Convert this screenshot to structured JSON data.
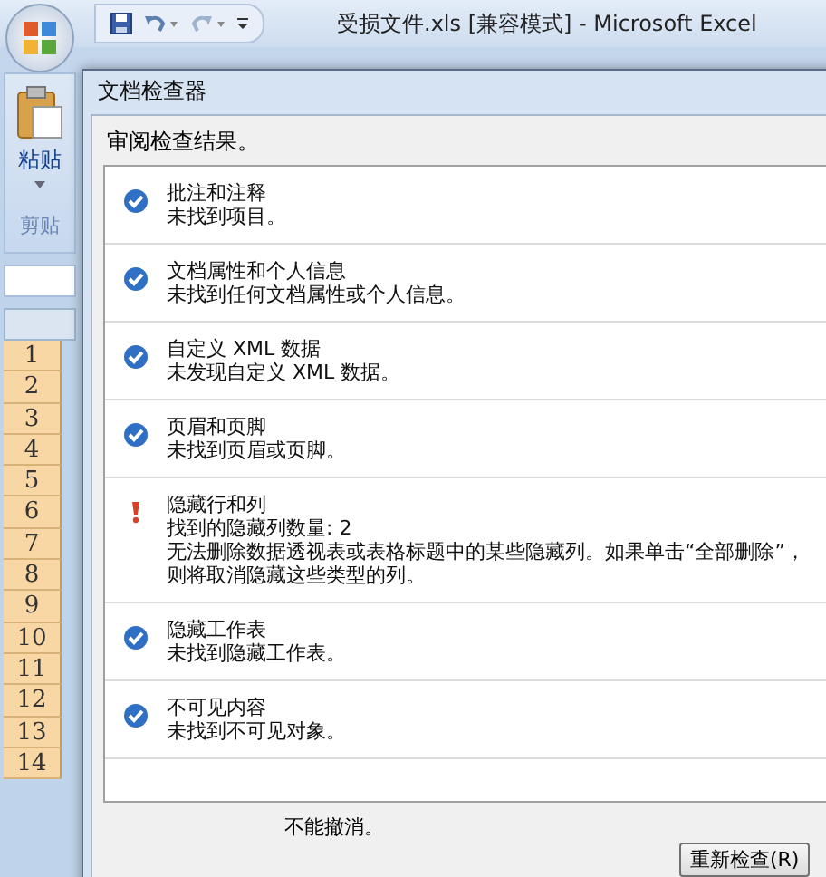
{
  "window": {
    "title": "受损文件.xls  [兼容模式] - Microsoft Excel"
  },
  "ribbon": {
    "paste_label": "粘贴",
    "group_label": "剪贴"
  },
  "sheet": {
    "row_numbers": [
      "1",
      "2",
      "3",
      "4",
      "5",
      "6",
      "7",
      "8",
      "9",
      "10",
      "11",
      "12",
      "13",
      "14"
    ]
  },
  "dialog": {
    "title": "文档检查器",
    "header": "审阅检查结果。",
    "results": [
      {
        "issue_found": false,
        "title": "批注和注释",
        "details": [
          "未找到项目。"
        ]
      },
      {
        "issue_found": false,
        "title": "文档属性和个人信息",
        "details": [
          "未找到任何文档属性或个人信息。"
        ]
      },
      {
        "issue_found": false,
        "title": "自定义 XML 数据",
        "details": [
          "未发现自定义 XML 数据。"
        ]
      },
      {
        "issue_found": false,
        "title": "页眉和页脚",
        "details": [
          "未找到页眉或页脚。"
        ]
      },
      {
        "issue_found": true,
        "title": "隐藏行和列",
        "details": [
          "找到的隐藏列数量: 2",
          "无法删除数据透视表或表格标题中的某些隐藏列。如果单击“全部删除”，则将取消隐藏这些类型的列。"
        ]
      },
      {
        "issue_found": false,
        "title": "隐藏工作表",
        "details": [
          "未找到隐藏工作表。"
        ]
      },
      {
        "issue_found": false,
        "title": "不可见内容",
        "details": [
          "未找到不可见对象。"
        ]
      }
    ],
    "footer_note": "不能撤消。",
    "buttons": [
      "重新检查(R)"
    ]
  }
}
